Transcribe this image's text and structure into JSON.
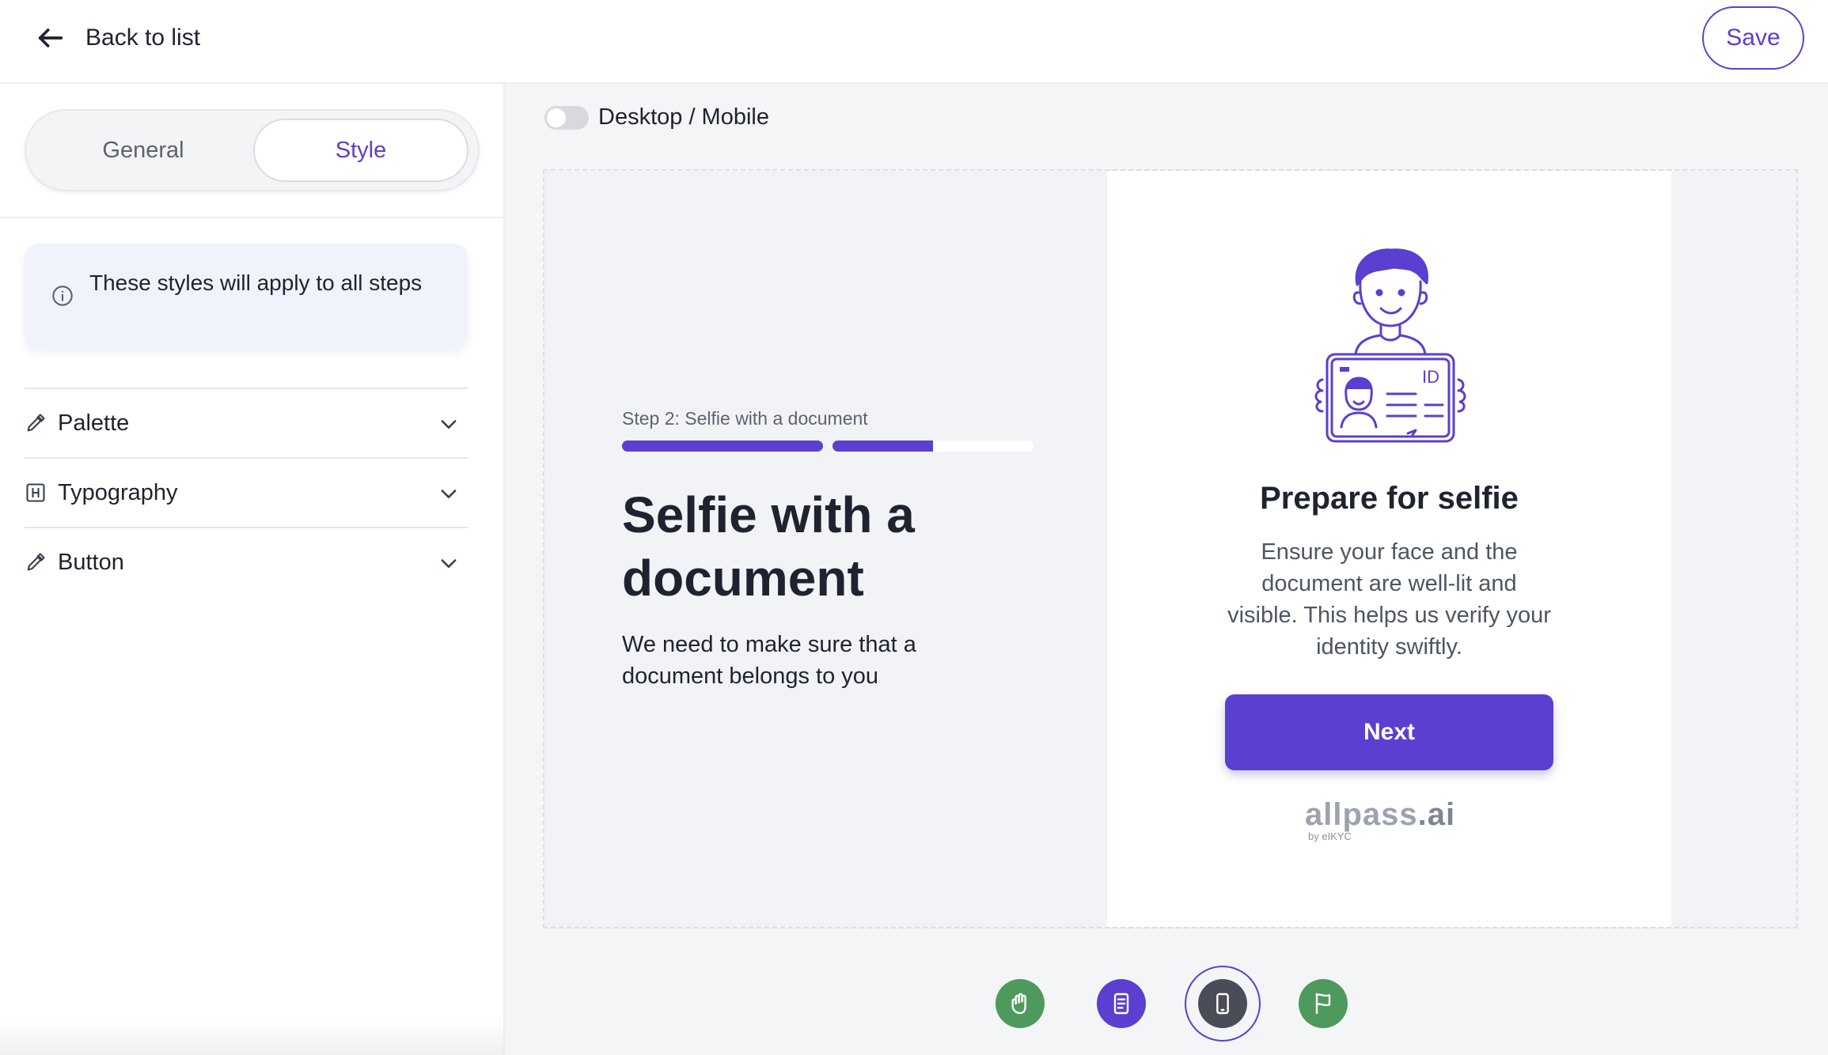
{
  "topbar": {
    "back_label": "Back to list",
    "save_label": "Save"
  },
  "sidebar": {
    "tabs": [
      {
        "label": "General",
        "active": false
      },
      {
        "label": "Style",
        "active": true
      }
    ],
    "info_text": "These styles will apply to all steps",
    "sections": [
      {
        "label": "Palette",
        "icon": "eyedropper-icon"
      },
      {
        "label": "Typography",
        "icon": "heading-icon"
      },
      {
        "label": "Button",
        "icon": "eyedropper-icon"
      }
    ]
  },
  "main": {
    "toggle_label": "Desktop / Mobile",
    "toggle_on": false,
    "preview": {
      "step_label": "Step 2: Selfie with a document",
      "progress": {
        "segments": 2,
        "current": 2,
        "current_fraction": 0.5
      },
      "headline": "Selfie with a document",
      "subtext": "We need to make sure that a document belongs to you",
      "card": {
        "illustration": "person-holding-id-card",
        "id_text": "ID",
        "title": "Prepare for selfie",
        "description": "Ensure your face and the document are well-lit and visible. This helps us verify your identity swiftly.",
        "button_label": "Next",
        "brand_main": "allpass",
        "brand_tld": ".ai",
        "brand_sub": "by eIKYC"
      }
    },
    "step_nav": [
      {
        "icon": "hand-icon",
        "color": "#4e9a5c",
        "active": false
      },
      {
        "icon": "document-icon",
        "color": "#5b3fd0",
        "active": false
      },
      {
        "icon": "phone-icon",
        "color": "#4a4d57",
        "active": true
      },
      {
        "icon": "flag-icon",
        "color": "#4e9a5c",
        "active": false
      }
    ]
  },
  "colors": {
    "accent": "#5b3fd0",
    "text": "#1f2330",
    "muted": "#5b6270",
    "panel_bg": "#f4f5f7",
    "info_bg": "#f0f3fb",
    "success": "#4e9a5c"
  }
}
